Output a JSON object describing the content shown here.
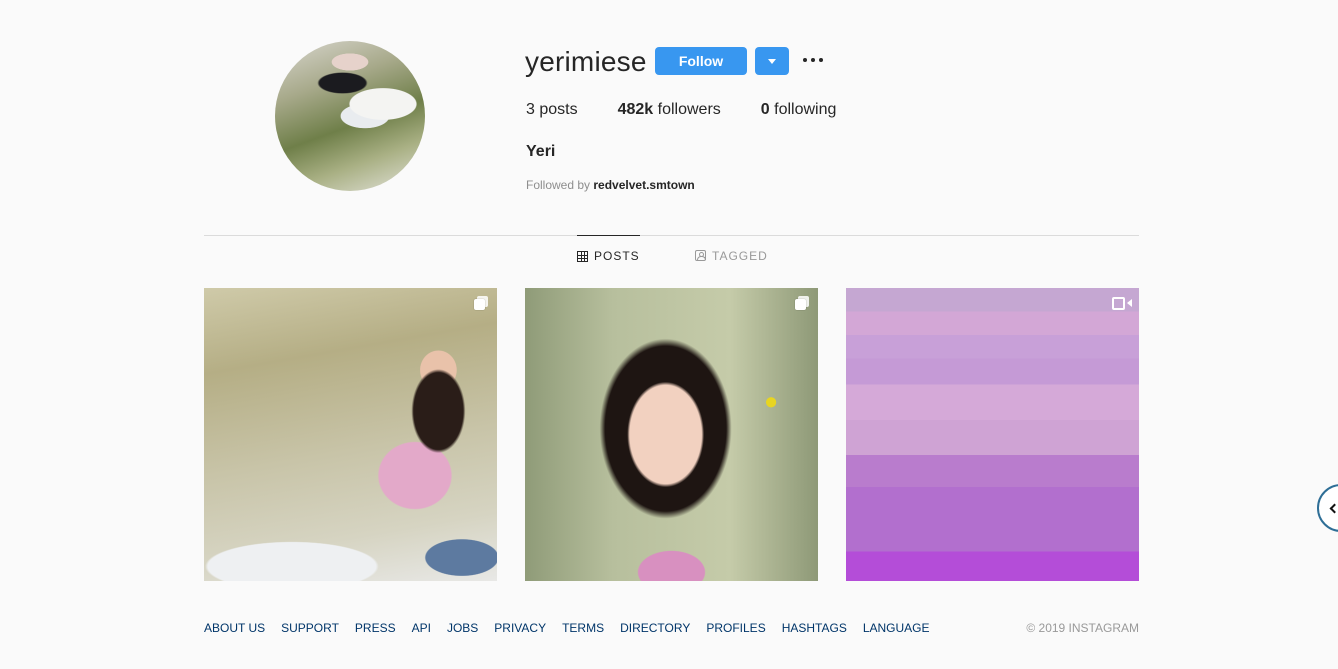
{
  "profile": {
    "username": "yerimiese",
    "follow_label": "Follow",
    "full_name": "Yeri",
    "followed_by_prefix": "Followed by",
    "followed_by_user": "redvelvet.smtown",
    "stats": {
      "posts_count": "3",
      "posts_label": " posts",
      "followers_count": "482k",
      "followers_label": " followers",
      "following_count": "0",
      "following_label": " following"
    }
  },
  "tabs": {
    "posts": "POSTS",
    "tagged": "TAGGED",
    "active": "posts"
  },
  "posts": [
    {
      "type": "carousel",
      "icon": "multiple-images-icon"
    },
    {
      "type": "carousel",
      "icon": "multiple-images-icon"
    },
    {
      "type": "video",
      "icon": "video-camera-icon"
    }
  ],
  "footer": {
    "links": [
      "ABOUT US",
      "SUPPORT",
      "PRESS",
      "API",
      "JOBS",
      "PRIVACY",
      "TERMS",
      "DIRECTORY",
      "PROFILES",
      "HASHTAGS",
      "LANGUAGE"
    ],
    "copyright": "© 2019 INSTAGRAM"
  },
  "colors": {
    "accent": "#3897f0",
    "background": "#fafafa",
    "link": "#003569"
  }
}
